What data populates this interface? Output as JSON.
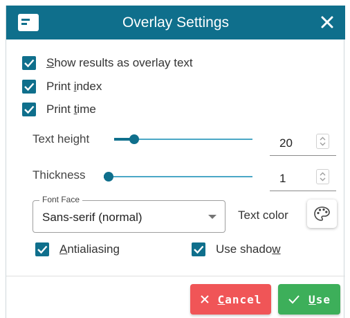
{
  "dialog": {
    "title": "Overlay Settings",
    "title_icon": "window-card-icon",
    "close_icon": "close-icon"
  },
  "options": {
    "show_results": {
      "pre": "",
      "key": "S",
      "post": "how results as overlay text",
      "checked": true
    },
    "print_index": {
      "pre": "Print ",
      "key": "i",
      "post": "ndex",
      "checked": true
    },
    "print_time": {
      "pre": "Print ",
      "key": "t",
      "post": "ime",
      "checked": true
    }
  },
  "text_height": {
    "label": "Text height",
    "value": "20",
    "level": 0.12
  },
  "thickness": {
    "label": "Thickness",
    "value": "1",
    "level": 0.0
  },
  "font_face": {
    "label": "Font Face",
    "value": "Sans-serif (normal)"
  },
  "text_color": {
    "label": "Text color",
    "icon": "palette-icon"
  },
  "antialiasing": {
    "pre": "",
    "key": "A",
    "post": "ntialiasing",
    "checked": true
  },
  "use_shadow": {
    "pre": "Use shado",
    "key": "w",
    "post": "",
    "checked": true
  },
  "buttons": {
    "cancel": {
      "key": "C",
      "rest": "ancel",
      "color": "#f05557"
    },
    "use": {
      "key": "U",
      "rest": "se",
      "color": "#3daf5a"
    }
  },
  "colors": {
    "primary": "#0f6f8c"
  }
}
